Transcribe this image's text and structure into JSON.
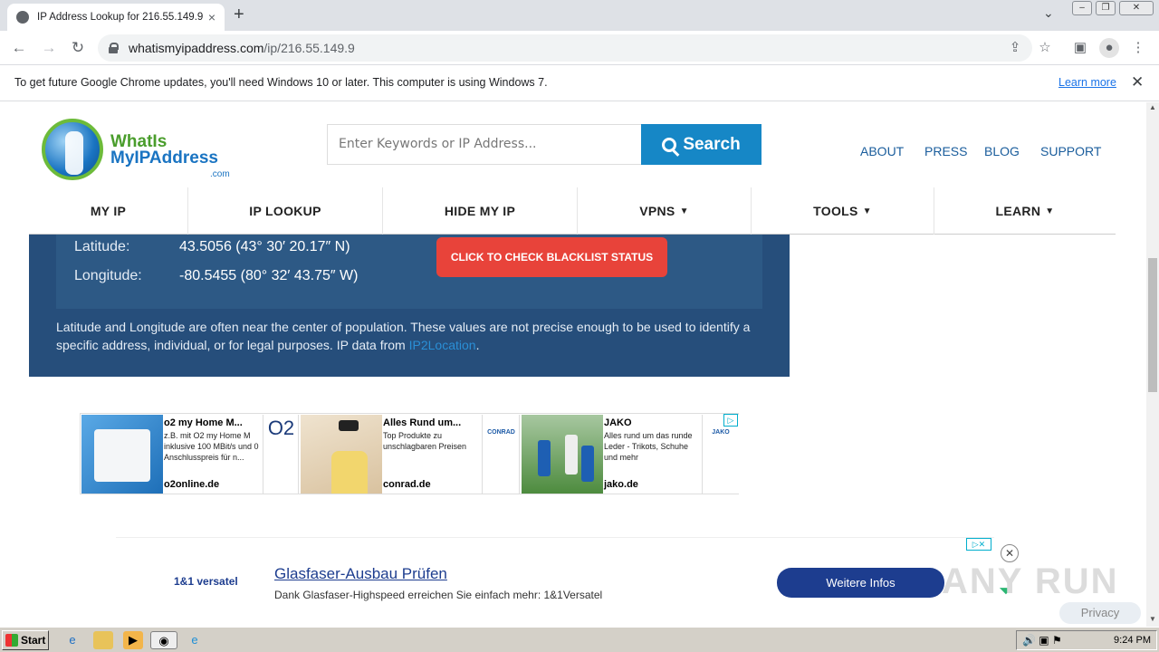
{
  "browser": {
    "tab_title": "IP Address Lookup for 216.55.149.9",
    "url_domain": "whatismyipaddress.com",
    "url_path": "/ip/216.55.149.9",
    "new_tab": "+",
    "close_tab": "×"
  },
  "infobar": {
    "message": "To get future Google Chrome updates, you'll need Windows 10 or later. This computer is using Windows 7.",
    "learn_more": "Learn more",
    "close": "✕"
  },
  "site": {
    "logo_line1": "WhatIs",
    "logo_line2": "MyIPAddress",
    "logo_suffix": ".com",
    "search_placeholder": "Enter Keywords or IP Address...",
    "search_button": "Search",
    "top_links": [
      "ABOUT",
      "PRESS",
      "BLOG",
      "SUPPORT"
    ],
    "nav": [
      {
        "label": "MY IP",
        "caret": ""
      },
      {
        "label": "IP LOOKUP",
        "caret": ""
      },
      {
        "label": "HIDE MY IP",
        "caret": ""
      },
      {
        "label": "VPNS",
        "caret": "▼"
      },
      {
        "label": "TOOLS",
        "caret": "▼"
      },
      {
        "label": "LEARN",
        "caret": "▼"
      }
    ]
  },
  "geo": {
    "latitude_label": "Latitude:",
    "latitude_value": "43.5056 (43° 30′ 20.17″ N)",
    "longitude_label": "Longitude:",
    "longitude_value": "-80.5455 (80° 32′ 43.75″ W)",
    "blacklist_button": "CLICK TO CHECK BLACKLIST STATUS",
    "note": "Latitude and Longitude are often near the center of population. These values are not precise enough to be used to identify a specific address, individual, or for legal purposes. IP data from ",
    "note_link": "IP2Location",
    "note_end": "."
  },
  "ads": [
    {
      "title": "o2 my Home M...",
      "text": "z.B. mit O2 my Home M inklusive 100 MBit/s und 0 Anschlusspreis für n...",
      "domain": "o2online.de",
      "logo": "O2"
    },
    {
      "title": "Alles Rund um...",
      "text": "Top Produkte zu unschlagbaren Preisen",
      "domain": "conrad.de",
      "logo": "CONRAD"
    },
    {
      "title": "JAKO",
      "text": "Alles rund um das runde Leder - Trikots, Schuhe und mehr",
      "domain": "jako.de",
      "logo": "JAKO"
    }
  ],
  "bottom_ad": {
    "brand": "1&1 versatel",
    "headline": "Glasfaser-Ausbau Prüfen",
    "subline": "Dank Glasfaser-Highspeed erreichen Sie einfach mehr: 1&1Versatel",
    "cta": "Weitere Infos"
  },
  "watermark": "ANY RUN",
  "privacy": "Privacy",
  "taskbar": {
    "start": "Start",
    "clock": "9:24 PM"
  }
}
